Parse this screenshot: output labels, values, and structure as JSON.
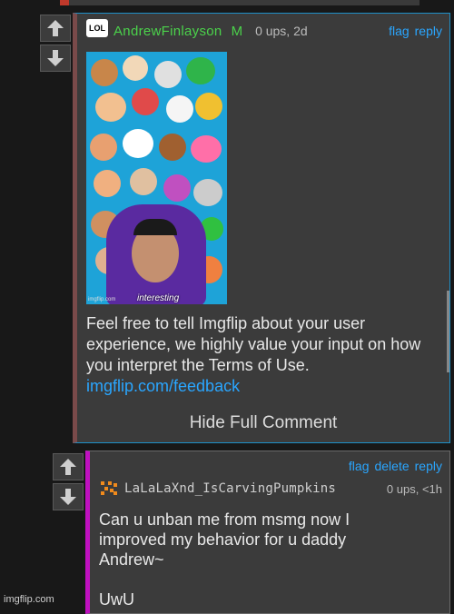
{
  "comment1": {
    "username": "AndrewFinlayson",
    "mod_badge": "M",
    "meta": "0 ups, 2d",
    "flag": "flag",
    "reply": "reply",
    "meme_caption": "interesting",
    "meme_watermark": "imgflip.com",
    "body": "Feel free to tell Imgflip about your user experience, we highly value your input on how you interpret the Terms of Use.",
    "link": "imgflip.com/feedback",
    "hide": "Hide Full Comment"
  },
  "comment2": {
    "flag": "flag",
    "delete": "delete",
    "reply": "reply",
    "username": "LaLaLaXnd_IsCarvingPumpkins",
    "meta": "0 ups, <1h",
    "body": "Can u unban me from msmg now I\nimproved my behavior for u daddy\nAndrew~\n\nUwU"
  },
  "watermark": "imgflip.com",
  "colors": {
    "link": "#2aa6ff",
    "mod_green": "#4bd24b",
    "accent_border": "#1e90c8"
  }
}
